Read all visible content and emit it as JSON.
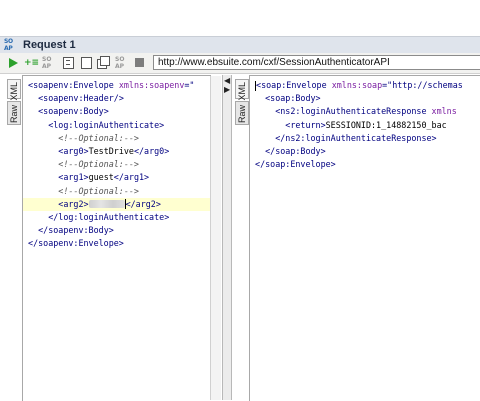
{
  "window": {
    "title": "Request 1",
    "app_icon_text": "SO\nAP"
  },
  "toolbar": {
    "endpoint_url": "http://www.ebsuite.com/cxf/SessionAuthenticatorAPI",
    "buttons": [
      "run",
      "add-step",
      "soap",
      "editor",
      "form",
      "copy",
      "soap",
      "cancel"
    ]
  },
  "request": {
    "side_tabs": [
      "XML",
      "Raw"
    ],
    "lines": [
      {
        "indent": 0,
        "parts": [
          [
            "tag",
            "<soapenv:Envelope "
          ],
          [
            "attr",
            "xmlns:soapenv"
          ],
          [
            "tag",
            "=\""
          ]
        ]
      },
      {
        "indent": 2,
        "parts": [
          [
            "tag",
            "<soapenv:Header/>"
          ]
        ]
      },
      {
        "indent": 2,
        "parts": [
          [
            "tag",
            "<soapenv:Body>"
          ]
        ]
      },
      {
        "indent": 4,
        "parts": [
          [
            "tag",
            "<log:loginAuthenticate>"
          ]
        ]
      },
      {
        "indent": 6,
        "parts": [
          [
            "cm",
            "<!--Optional:-->"
          ]
        ]
      },
      {
        "indent": 6,
        "parts": [
          [
            "tag",
            "<arg0>"
          ],
          [
            "txt",
            "TestDrive"
          ],
          [
            "tag",
            "</arg0>"
          ]
        ]
      },
      {
        "indent": 6,
        "parts": [
          [
            "cm",
            "<!--Optional:-->"
          ]
        ]
      },
      {
        "indent": 6,
        "parts": [
          [
            "tag",
            "<arg1>"
          ],
          [
            "txt",
            "guest"
          ],
          [
            "tag",
            "</arg1>"
          ]
        ]
      },
      {
        "indent": 6,
        "parts": [
          [
            "cm",
            "<!--Optional:-->"
          ]
        ]
      },
      {
        "indent": 6,
        "parts": [
          [
            "tag",
            "<arg2>"
          ],
          [
            "blur",
            ""
          ],
          [
            "caret",
            ""
          ],
          [
            "tag",
            "</arg2>"
          ]
        ],
        "highlight": true
      },
      {
        "indent": 4,
        "parts": [
          [
            "tag",
            "</log:loginAuthenticate>"
          ]
        ]
      },
      {
        "indent": 2,
        "parts": [
          [
            "tag",
            "</soapenv:Body>"
          ]
        ]
      },
      {
        "indent": 0,
        "parts": [
          [
            "tag",
            "</soapenv:Envelope>"
          ]
        ]
      }
    ]
  },
  "response": {
    "side_tabs": [
      "XML",
      "Raw"
    ],
    "lines": [
      {
        "indent": 0,
        "parts": [
          [
            "caret",
            ""
          ],
          [
            "tag",
            "<soap:Envelope "
          ],
          [
            "attr",
            "xmlns:soap"
          ],
          [
            "tag",
            "=\"http://schemas"
          ]
        ]
      },
      {
        "indent": 2,
        "parts": [
          [
            "tag",
            "<soap:Body>"
          ]
        ]
      },
      {
        "indent": 4,
        "parts": [
          [
            "tag",
            "<ns2:loginAuthenticateResponse "
          ],
          [
            "attr",
            "xmlns"
          ]
        ]
      },
      {
        "indent": 6,
        "parts": [
          [
            "tag",
            "<return>"
          ],
          [
            "txt",
            "SESSIONID:1_14882150_bac"
          ]
        ]
      },
      {
        "indent": 4,
        "parts": [
          [
            "tag",
            "</ns2:loginAuthenticateResponse>"
          ]
        ]
      },
      {
        "indent": 2,
        "parts": [
          [
            "tag",
            "</soap:Body>"
          ]
        ]
      },
      {
        "indent": 0,
        "parts": [
          [
            "tag",
            "</soap:Envelope>"
          ]
        ]
      }
    ]
  }
}
